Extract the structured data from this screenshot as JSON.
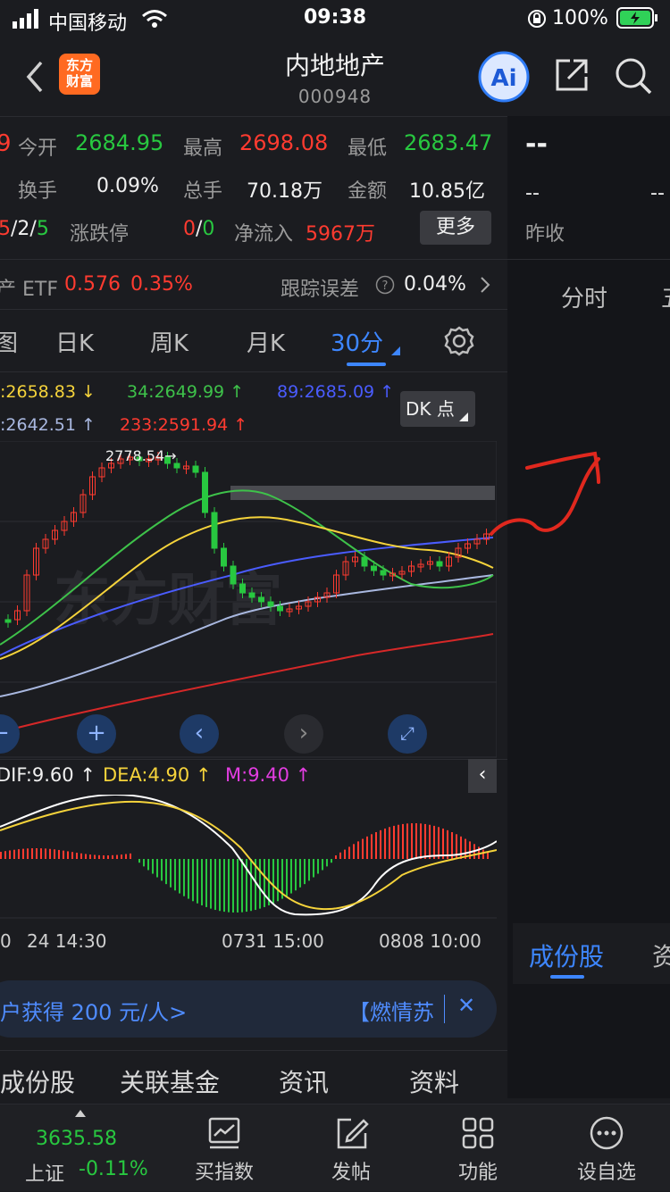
{
  "status_bar": {
    "carrier": "中国移动",
    "time": "09:38",
    "battery": "100%"
  },
  "nav": {
    "title": "内地地产",
    "code": "000948",
    "logo_line1": "东方",
    "logo_line2": "财富",
    "ai_label": "Ai"
  },
  "quote": {
    "left_digit": "9",
    "open_label": "今开",
    "open": "2684.95",
    "high_label": "最高",
    "high": "2698.08",
    "low_label": "最低",
    "low": "2683.47",
    "turnover_label": "换手",
    "turnover": "0.09%",
    "volume_label": "总手",
    "volume": "70.18万",
    "amount_label": "金额",
    "amount": "10.85亿",
    "ratio_red": "5",
    "ratio_sep1": "/",
    "ratio_mid": "2",
    "ratio_sep2": "/",
    "ratio_green": "5",
    "limit_label": "涨跌停",
    "limit_up": "0",
    "limit_sep": "/",
    "limit_down": "0",
    "netflow_label": "净流入",
    "netflow": "5967万",
    "more_label": "更多"
  },
  "etf": {
    "label": "产 ETF",
    "price": "0.576",
    "change": "0.35%",
    "track_label": "跟踪误差",
    "track": "0.04%"
  },
  "right_quote": {
    "dash_big": "--",
    "dash1": "--",
    "dash2": "--",
    "prev_close_label": "昨收",
    "tab": "分时"
  },
  "tabs": [
    "日K",
    "周K",
    "月K",
    "30分"
  ],
  "tab_partial": "图",
  "ma": {
    "ma1": ":2658.83 ↓",
    "ma2": "34:2649.99 ↑",
    "ma3": "89:2685.09 ↑",
    "ma4": ":2642.51 ↑",
    "ma5": "233:2591.94 ↑",
    "dk_label": "DK 点"
  },
  "chart_annot": {
    "high_marker": "2778.54→"
  },
  "watermark": "东方财富",
  "macd": {
    "dif": "DIF:9.60 ↑",
    "dea": "DEA:4.90 ↑",
    "m": "M:9.40 ↑"
  },
  "time_axis": [
    "0",
    "24 14:30",
    "0731 15:00",
    "0808 10:00"
  ],
  "banner": {
    "left": "户获得 200 元/人>",
    "right": "【燃情苏超"
  },
  "right_bottom_tab": {
    "label": "成份股",
    "partial": "资"
  },
  "section_tabs": [
    "成份股",
    "关联基金",
    "资讯",
    "资料"
  ],
  "bottom_nav": {
    "index_value": "3635.58",
    "index_name": "上证",
    "index_change": "-0.11%",
    "items": [
      "买指数",
      "发帖",
      "功能",
      "设自选"
    ]
  },
  "colors": {
    "up": "#ff3b30",
    "down": "#28c840",
    "accent": "#2f7bf5",
    "bg": "#1b1c20"
  }
}
